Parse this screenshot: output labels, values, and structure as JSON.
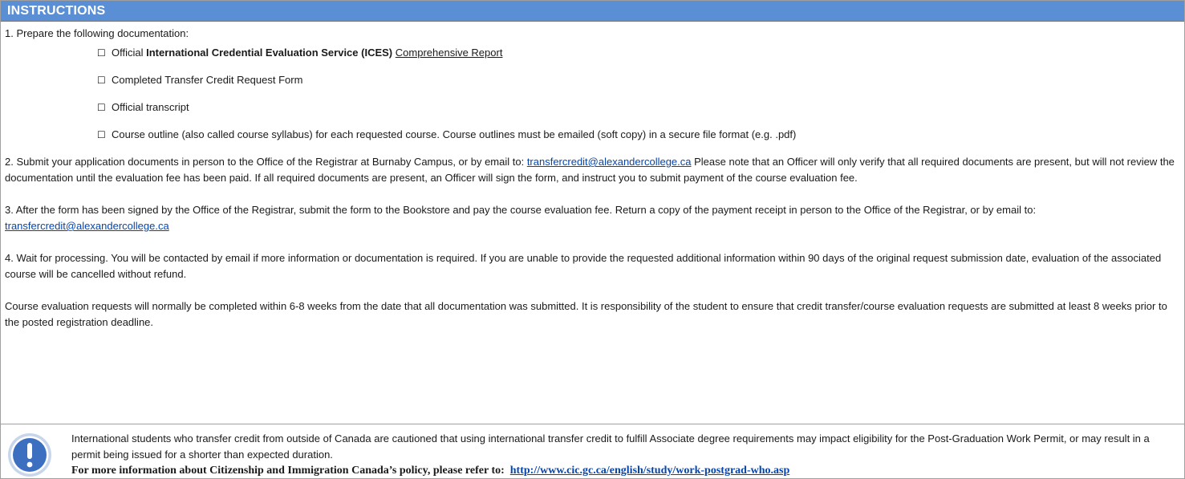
{
  "header": {
    "title": "INSTRUCTIONS"
  },
  "step1": {
    "text": "1. Prepare the following documentation:",
    "items": [
      {
        "prefix": "Official ",
        "bold": "International Credential Evaluation Service (ICES)",
        "underlined": "Comprehensive Report"
      },
      {
        "text": "Completed Transfer Credit Request Form"
      },
      {
        "text": "Official transcript"
      },
      {
        "text": "Course outline (also called course syllabus) for each requested course. Course outlines must be emailed (soft copy) in a secure file format (e.g. .pdf)"
      }
    ],
    "checkbox_glyph": "☐"
  },
  "step2": {
    "before": "2. Submit your application documents in person to the Office of the Registrar at Burnaby Campus, or by email to: ",
    "email": "transfercredit@alexandercollege.ca",
    "after": "  Please note that an Officer will only verify that all required documents are present, but will not review the documentation until the evaluation fee has been paid. If all required documents are present, an Officer will sign the form, and instruct you to submit payment of the course evaluation fee."
  },
  "step3": {
    "before": "3. After the form has been signed by the Office of the Registrar, submit the form to the Bookstore and pay the course evaluation fee.  Return a copy of the payment receipt in person to the Office of the Registrar, or by email to: ",
    "email": "transfercredit@alexandercollege.ca"
  },
  "step4": {
    "text": "4. Wait for processing. You will be contacted by email if more information or documentation is required. If you are unable to provide the requested additional information within 90 days of the original request submission date, evaluation of the associated course will be cancelled without refund."
  },
  "closing": {
    "text": "Course evaluation requests will normally be completed within 6-8 weeks from the date that all documentation was submitted. It is responsibility of the student to ensure that credit transfer/course evaluation requests are submitted at least 8 weeks prior to the posted registration deadline."
  },
  "notice": {
    "icon": "exclamation-icon",
    "text": "International students who transfer credit from outside of Canada are cautioned that using international transfer credit to fulfill Associate degree requirements may impact eligibility for the Post-Graduation Work Permit, or may result in a permit being issued for a shorter than expected duration.",
    "more_label": "For more information about Citizenship and Immigration Canada’s policy, please refer to:",
    "url": "http://www.cic.gc.ca/english/study/work-postgrad-who.asp"
  },
  "colors": {
    "header_bg": "#5a8fd6",
    "link": "#0645ad",
    "icon_blue": "#3d6fc1"
  }
}
